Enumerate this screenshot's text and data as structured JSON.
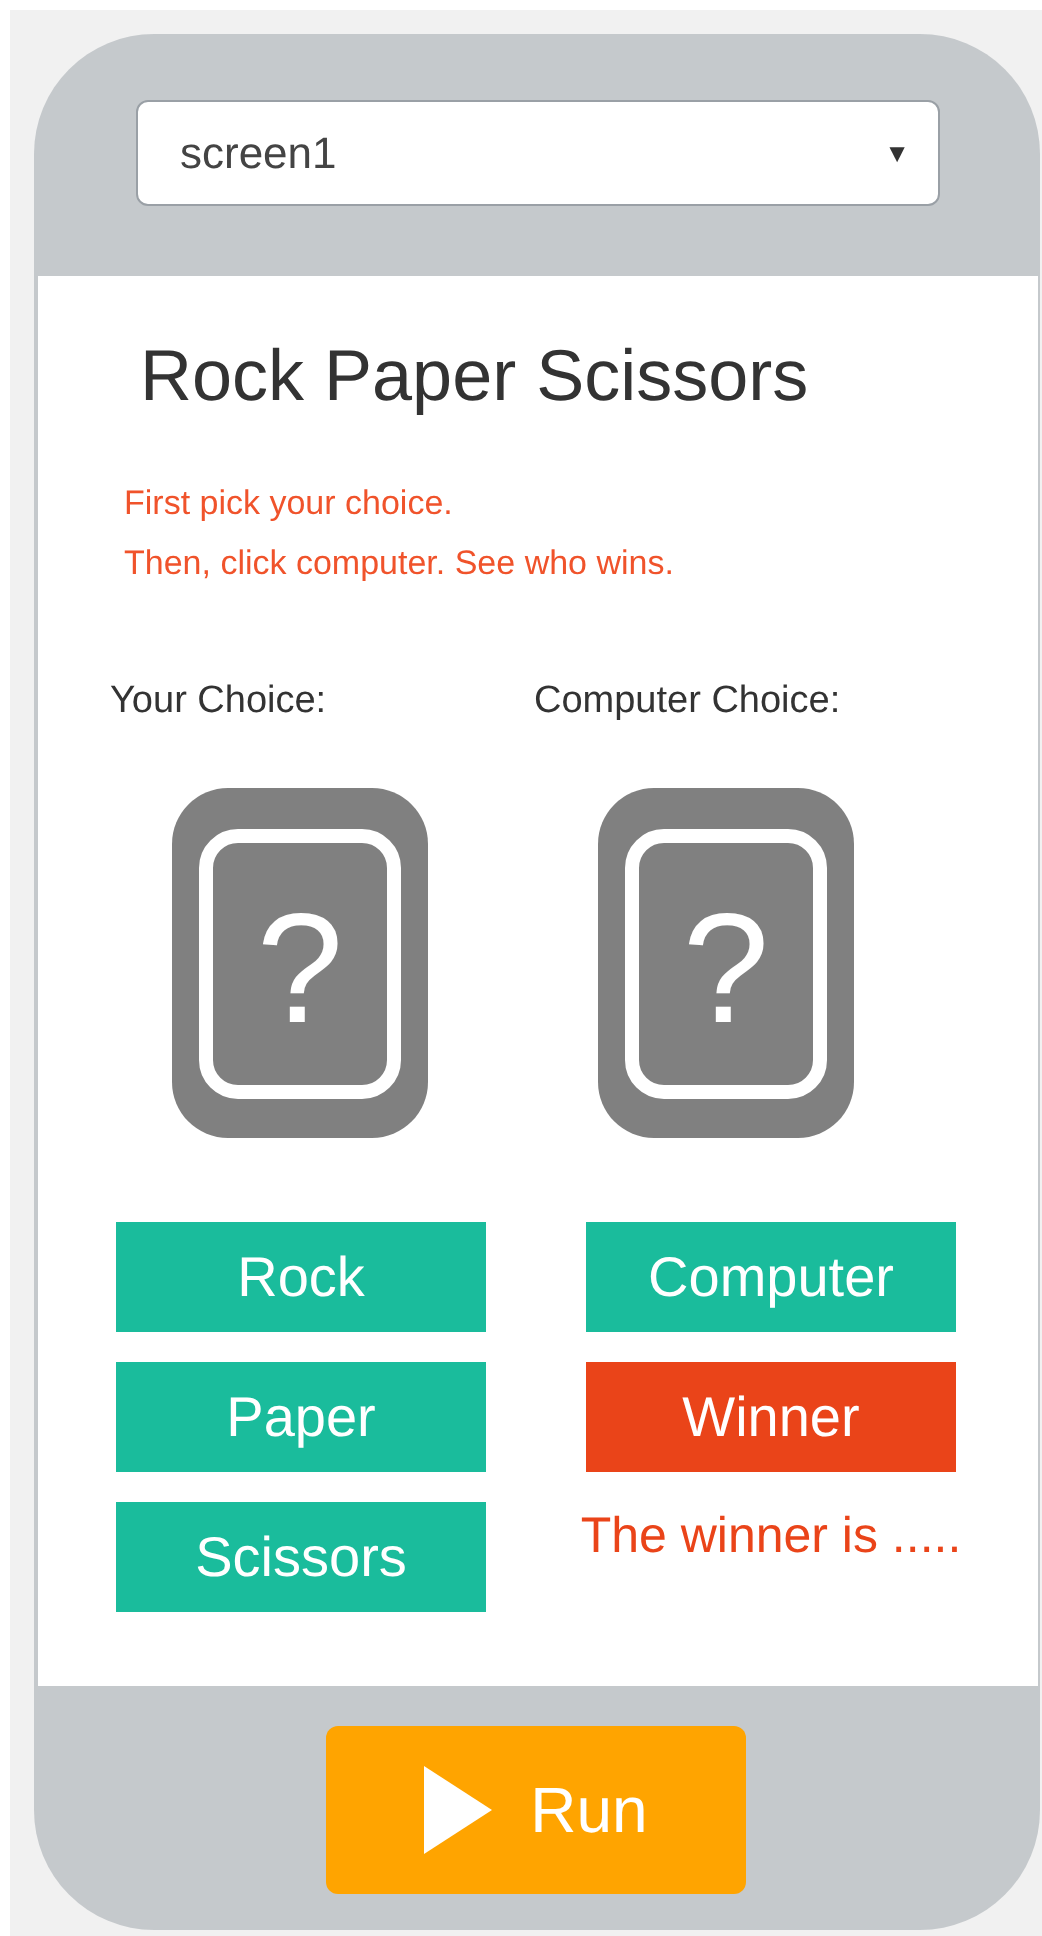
{
  "screen_selector": {
    "value": "screen1",
    "caret": "▼"
  },
  "title": "Rock Paper Scissors",
  "instructions": [
    "First pick your choice.",
    "Then, click computer. See who wins."
  ],
  "choices": [
    {
      "label": "Your Choice:",
      "symbol": "?"
    },
    {
      "label": "Computer Choice:",
      "symbol": "?"
    }
  ],
  "left_buttons": [
    {
      "label": "Rock",
      "color": "#1abc9c"
    },
    {
      "label": "Paper",
      "color": "#1abc9c"
    },
    {
      "label": "Scissors",
      "color": "#1abc9c"
    }
  ],
  "right_buttons": [
    {
      "label": "Computer",
      "color": "#1abc9c"
    },
    {
      "label": "Winner",
      "color": "#ea4419"
    }
  ],
  "result": "The winner is .....",
  "run_button": {
    "label": "Run"
  }
}
